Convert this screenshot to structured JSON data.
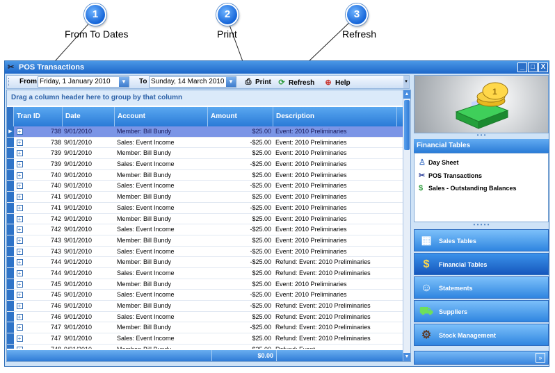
{
  "callouts": [
    {
      "number": "1",
      "label": "From To Dates"
    },
    {
      "number": "2",
      "label": "Print"
    },
    {
      "number": "3",
      "label": "Refresh"
    }
  ],
  "window": {
    "title": "POS Transactions",
    "controls": {
      "minimize": "_",
      "maximize": "□",
      "close": "X"
    }
  },
  "toolbar": {
    "from_label": "From",
    "from_value": "Friday, 1 January 2010",
    "to_label": "To",
    "to_value": "Sunday, 14 March 2010",
    "print_label": "Print",
    "refresh_label": "Refresh",
    "help_label": "Help"
  },
  "grid": {
    "group_hint": "Drag a column header here to group by that column",
    "columns": [
      "Tran ID",
      "Date",
      "Account",
      "Amount",
      "Description"
    ],
    "rows": [
      {
        "id": "738",
        "date": "9/01/2010",
        "account": "Member: Bill Bundy",
        "amount": "$25.00",
        "description": "Event: 2010 Preliminaries",
        "selected": true
      },
      {
        "id": "738",
        "date": "9/01/2010",
        "account": "Sales: Event Income",
        "amount": "-$25.00",
        "description": "Event: 2010 Preliminaries"
      },
      {
        "id": "739",
        "date": "9/01/2010",
        "account": "Member: Bill Bundy",
        "amount": "$25.00",
        "description": "Event: 2010 Preliminaries"
      },
      {
        "id": "739",
        "date": "9/01/2010",
        "account": "Sales: Event Income",
        "amount": "-$25.00",
        "description": "Event: 2010 Preliminaries"
      },
      {
        "id": "740",
        "date": "9/01/2010",
        "account": "Member: Bill Bundy",
        "amount": "$25.00",
        "description": "Event: 2010 Preliminaries"
      },
      {
        "id": "740",
        "date": "9/01/2010",
        "account": "Sales: Event Income",
        "amount": "-$25.00",
        "description": "Event: 2010 Preliminaries"
      },
      {
        "id": "741",
        "date": "9/01/2010",
        "account": "Member: Bill Bundy",
        "amount": "$25.00",
        "description": "Event: 2010 Preliminaries"
      },
      {
        "id": "741",
        "date": "9/01/2010",
        "account": "Sales: Event Income",
        "amount": "-$25.00",
        "description": "Event: 2010 Preliminaries"
      },
      {
        "id": "742",
        "date": "9/01/2010",
        "account": "Member: Bill Bundy",
        "amount": "$25.00",
        "description": "Event: 2010 Preliminaries"
      },
      {
        "id": "742",
        "date": "9/01/2010",
        "account": "Sales: Event Income",
        "amount": "-$25.00",
        "description": "Event: 2010 Preliminaries"
      },
      {
        "id": "743",
        "date": "9/01/2010",
        "account": "Member: Bill Bundy",
        "amount": "$25.00",
        "description": "Event: 2010 Preliminaries"
      },
      {
        "id": "743",
        "date": "9/01/2010",
        "account": "Sales: Event Income",
        "amount": "-$25.00",
        "description": "Event: 2010 Preliminaries"
      },
      {
        "id": "744",
        "date": "9/01/2010",
        "account": "Member: Bill Bundy",
        "amount": "-$25.00",
        "description": "Refund: Event: 2010 Preliminaries"
      },
      {
        "id": "744",
        "date": "9/01/2010",
        "account": "Sales: Event Income",
        "amount": "$25.00",
        "description": "Refund: Event: 2010 Preliminaries"
      },
      {
        "id": "745",
        "date": "9/01/2010",
        "account": "Member: Bill Bundy",
        "amount": "$25.00",
        "description": "Event: 2010 Preliminaries"
      },
      {
        "id": "745",
        "date": "9/01/2010",
        "account": "Sales: Event Income",
        "amount": "-$25.00",
        "description": "Event: 2010 Preliminaries"
      },
      {
        "id": "746",
        "date": "9/01/2010",
        "account": "Member: Bill Bundy",
        "amount": "-$25.00",
        "description": "Refund: Event: 2010 Preliminaries"
      },
      {
        "id": "746",
        "date": "9/01/2010",
        "account": "Sales: Event Income",
        "amount": "$25.00",
        "description": "Refund: Event: 2010 Preliminaries"
      },
      {
        "id": "747",
        "date": "9/01/2010",
        "account": "Member: Bill Bundy",
        "amount": "-$25.00",
        "description": "Refund: Event: 2010 Preliminaries"
      },
      {
        "id": "747",
        "date": "9/01/2010",
        "account": "Sales: Event Income",
        "amount": "$25.00",
        "description": "Refund: Event: 2010 Preliminaries"
      },
      {
        "id": "748",
        "date": "9/01/2010",
        "account": "Member: Bill Bundy",
        "amount": "-$25.00",
        "description": "Refund: Event..."
      }
    ],
    "footer_total": "$0.00"
  },
  "right_panel": {
    "financial_tables_header": "Financial Tables",
    "financial_items": [
      {
        "label": "Day Sheet",
        "icon": "day-sheet-icon"
      },
      {
        "label": "POS Transactions",
        "icon": "pos-icon"
      },
      {
        "label": "Sales - Outstanding Balances",
        "icon": "balances-icon"
      }
    ],
    "nav_buttons": [
      {
        "label": "Sales Tables",
        "icon": "sales-icon"
      },
      {
        "label": "Financial Tables",
        "icon": "money-icon",
        "active": true
      },
      {
        "label": "Statements",
        "icon": "statements-icon"
      },
      {
        "label": "Suppliers",
        "icon": "truck-icon"
      },
      {
        "label": "Stock Management",
        "icon": "forklift-icon"
      }
    ]
  },
  "colors": {
    "accent": "#2a7ad7",
    "titlebar": "#1d67c9",
    "selected_row": "#7b95e6"
  }
}
